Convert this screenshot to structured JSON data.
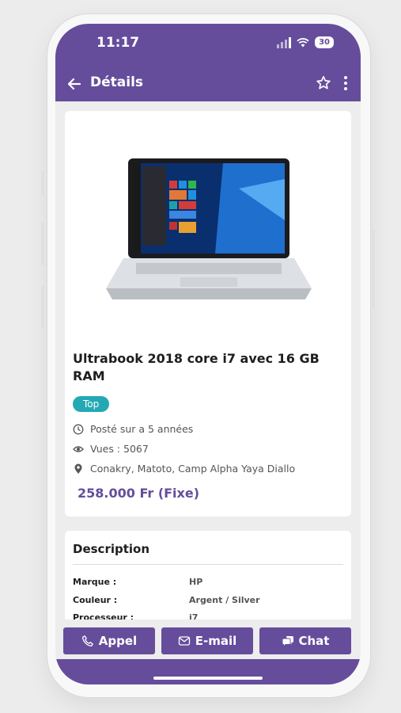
{
  "status_bar": {
    "time": "11:17",
    "battery": "30"
  },
  "app_bar": {
    "title": "Détails"
  },
  "product": {
    "title": "Ultrabook 2018 core i7 avec 16 GB RAM",
    "badge": "Top",
    "posted": "Posté sur a 5 années",
    "views": "Vues : 5067",
    "location": "Conakry, Matoto, Camp Alpha Yaya Diallo",
    "price": "258.000 Fr (Fixe)"
  },
  "description": {
    "title": "Description",
    "specs": [
      {
        "label": "Marque :",
        "value": "HP"
      },
      {
        "label": "Couleur :",
        "value": "Argent / Silver"
      },
      {
        "label": "Processeur :",
        "value": "i7"
      }
    ]
  },
  "actions": {
    "call": "Appel",
    "email": "E-mail",
    "chat": "Chat"
  },
  "colors": {
    "primary": "#654d9c",
    "badge": "#24a9b4"
  }
}
